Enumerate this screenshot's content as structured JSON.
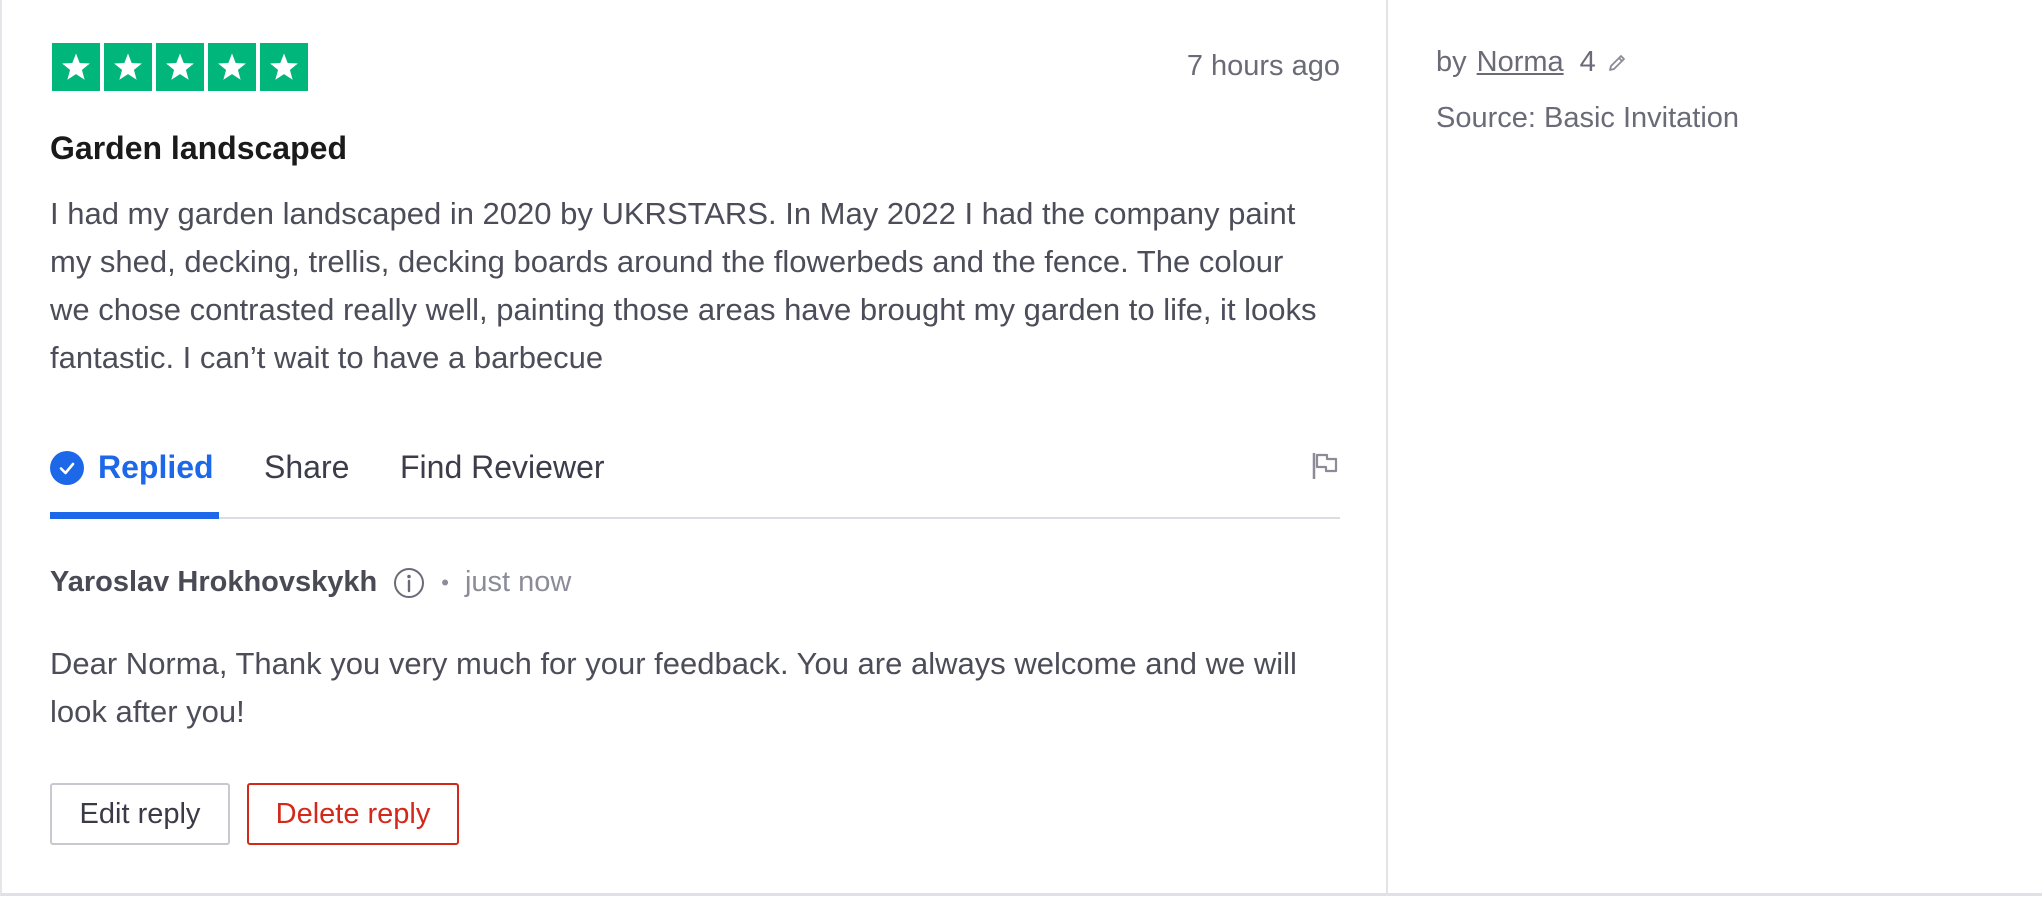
{
  "review": {
    "rating": 5,
    "rating_max": 5,
    "time": "7 hours ago",
    "title": "Garden landscaped",
    "body": "I had my garden landscaped in 2020 by UKRSTARS. In May 2022 I had the company paint my shed, decking, trellis, decking boards around the flowerbeds and the fence. The colour we chose contrasted really well, painting those areas have brought my garden to life, it looks fantastic. I can’t wait to have a barbecue"
  },
  "tabs": {
    "replied": "Replied",
    "share": "Share",
    "find_reviewer": "Find Reviewer"
  },
  "reply": {
    "author": "Yaroslav Hrokhovskykh",
    "separator": "•",
    "time": "just now",
    "text": "Dear Norma, Thank you very much for your feedback. You are always welcome and we will look after you!",
    "edit_label": "Edit reply",
    "delete_label": "Delete reply"
  },
  "sidebar": {
    "by_prefix": "by",
    "author": "Norma",
    "review_count": "4",
    "source": "Source: Basic Invitation"
  },
  "colors": {
    "star_green": "#00b67a",
    "accent_blue": "#1c68e8",
    "danger_red": "#d3291b"
  },
  "icons": {
    "star": "star-icon",
    "replied": "check-circle-icon",
    "flag": "flag-icon",
    "info": "info-icon",
    "edit": "pencil-icon"
  }
}
